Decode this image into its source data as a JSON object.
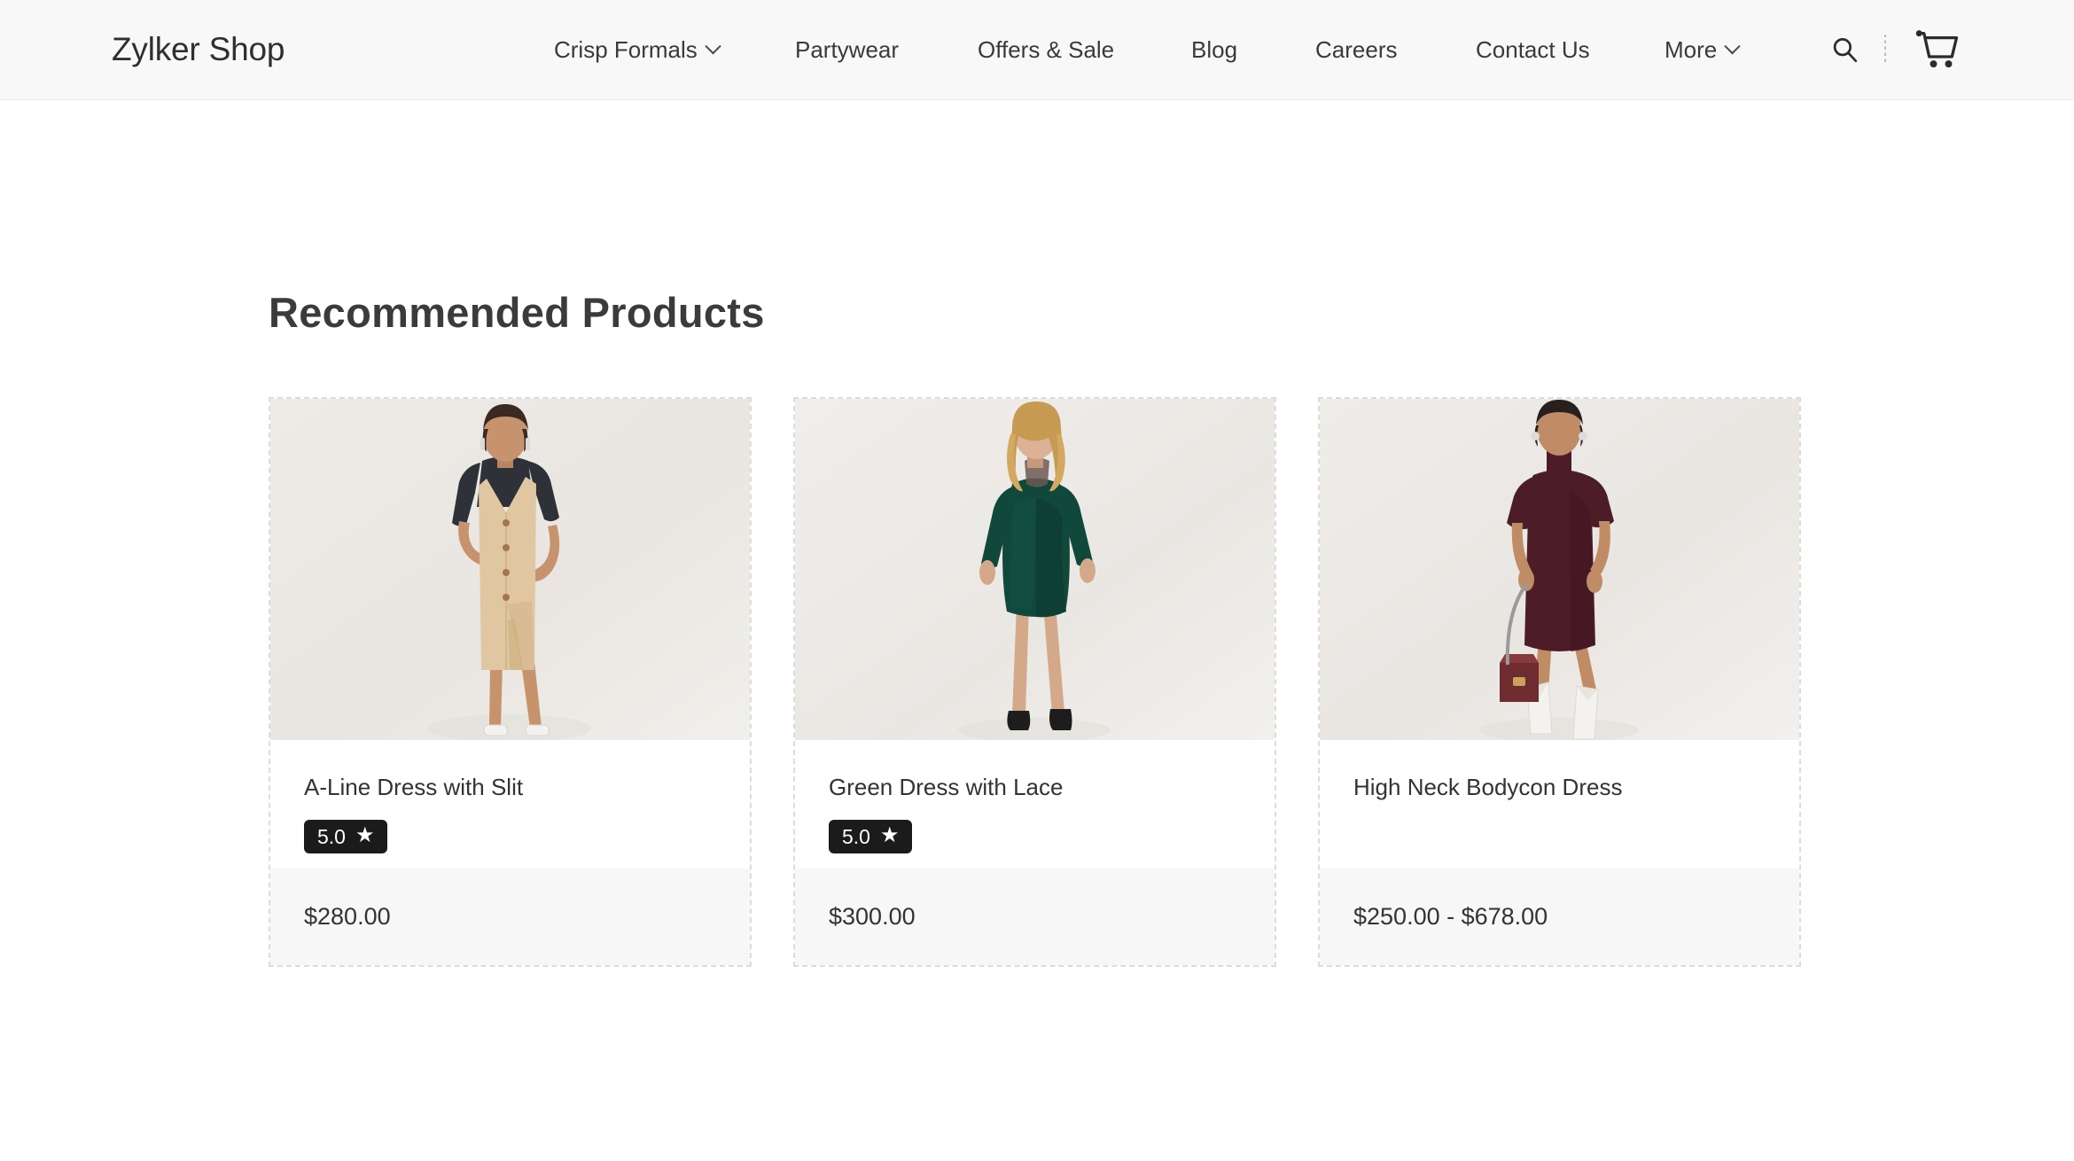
{
  "header": {
    "brand": "Zylker Shop",
    "nav": [
      {
        "label": "Crisp Formals",
        "has_dropdown": true
      },
      {
        "label": "Partywear",
        "has_dropdown": false
      },
      {
        "label": "Offers & Sale",
        "has_dropdown": false
      },
      {
        "label": "Blog",
        "has_dropdown": false
      },
      {
        "label": "Careers",
        "has_dropdown": false
      },
      {
        "label": "Contact Us",
        "has_dropdown": false
      },
      {
        "label": "More",
        "has_dropdown": true
      }
    ],
    "actions": {
      "search_icon": "search-icon",
      "cart_icon": "shopping-cart-icon"
    }
  },
  "main": {
    "section_title": "Recommended Products",
    "products": [
      {
        "title": "A-Line Dress with Slit",
        "rating": "5.0",
        "rating_star": "★",
        "price": "$280.00",
        "image_alt": "model-in-beige-button-front-midi-pinafore-dress"
      },
      {
        "title": "Green Dress with Lace",
        "rating": "5.0",
        "rating_star": "★",
        "price": "$300.00",
        "image_alt": "model-in-dark-green-long-sleeve-mini-dress"
      },
      {
        "title": "High Neck Bodycon Dress",
        "rating": null,
        "rating_star": null,
        "price": "$250.00 - $678.00",
        "image_alt": "model-in-burgundy-high-neck-short-sleeve-dress"
      }
    ]
  },
  "colors": {
    "header_bg": "#f8f8f8",
    "page_bg": "#ffffff",
    "card_border": "#dcdcdc",
    "price_bg": "#f7f7f7",
    "badge_bg": "#1b1b1b",
    "text": "#333333"
  }
}
